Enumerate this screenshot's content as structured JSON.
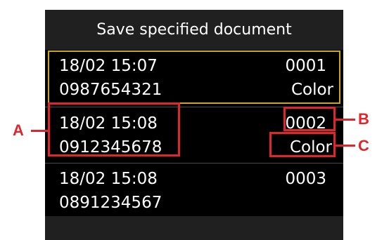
{
  "screen": {
    "title": "Save specified document",
    "documents": [
      {
        "datetime": "18/02 15:07",
        "number": "0987654321",
        "id": "0001",
        "mode": "Color",
        "selected": true
      },
      {
        "datetime": "18/02 15:08",
        "number": "0912345678",
        "id": "0002",
        "mode": "Color",
        "selected": false
      },
      {
        "datetime": "18/02 15:08",
        "number": "0891234567",
        "id": "0003",
        "mode": "",
        "selected": false
      }
    ]
  },
  "callouts": {
    "a": "A",
    "b": "B",
    "c": "C"
  },
  "colors": {
    "screen_background": "#000000",
    "title_background": "#202020",
    "selection_border": "#c8a81a",
    "callout_red": "#e0252b",
    "text": "#ffffff"
  }
}
